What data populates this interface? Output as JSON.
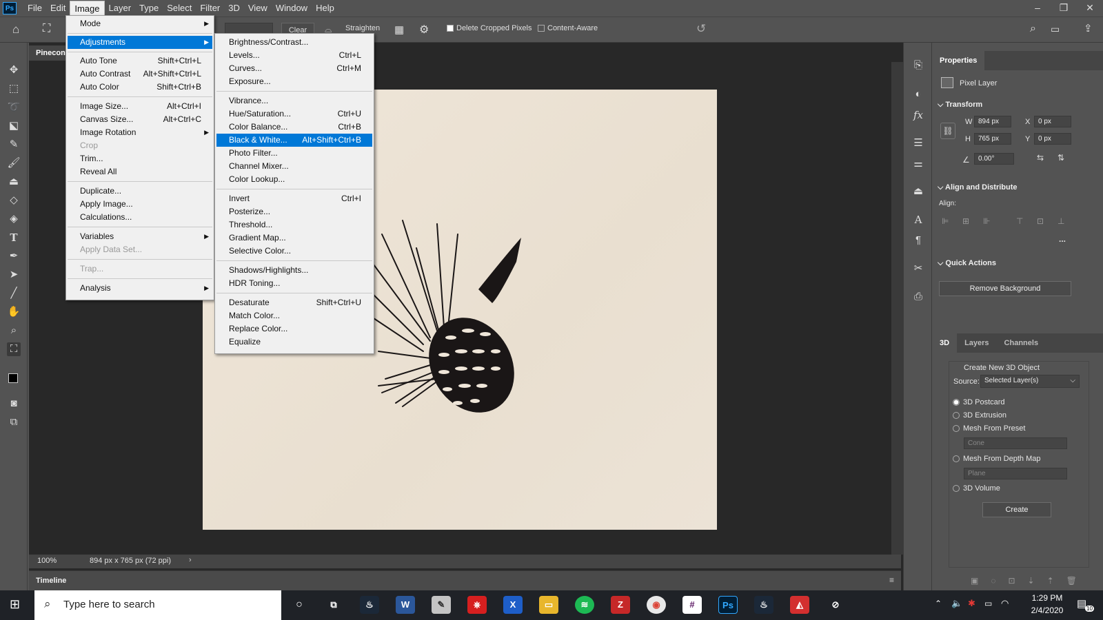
{
  "menubar": {
    "logo": "Ps",
    "items": [
      "File",
      "Edit",
      "Image",
      "Layer",
      "Type",
      "Select",
      "Filter",
      "3D",
      "View",
      "Window",
      "Help"
    ],
    "window_controls": [
      "–",
      "❐",
      "✕"
    ]
  },
  "options": {
    "clear": "Clear",
    "straighten": "Straighten",
    "delete_cropped": "Delete Cropped Pixels",
    "content_aware": "Content-Aware"
  },
  "document": {
    "tab": "Pinecon",
    "zoom": "100%",
    "info": "894 px x 765 px (72 ppi)"
  },
  "timeline": {
    "label": "Timeline"
  },
  "image_menu": {
    "items": [
      {
        "label": "Mode",
        "shortcut": "",
        "sub": "▶"
      },
      {
        "label": "Adjustments",
        "shortcut": "",
        "sub": "▶"
      },
      {
        "label": "Auto Tone",
        "shortcut": "Shift+Ctrl+L",
        "sub": ""
      },
      {
        "label": "Auto Contrast",
        "shortcut": "Alt+Shift+Ctrl+L",
        "sub": ""
      },
      {
        "label": "Auto Color",
        "shortcut": "Shift+Ctrl+B",
        "sub": ""
      },
      {
        "label": "Image Size...",
        "shortcut": "Alt+Ctrl+I",
        "sub": ""
      },
      {
        "label": "Canvas Size...",
        "shortcut": "Alt+Ctrl+C",
        "sub": ""
      },
      {
        "label": "Image Rotation",
        "shortcut": "",
        "sub": "▶"
      },
      {
        "label": "Crop",
        "shortcut": "",
        "sub": ""
      },
      {
        "label": "Trim...",
        "shortcut": "",
        "sub": ""
      },
      {
        "label": "Reveal All",
        "shortcut": "",
        "sub": ""
      },
      {
        "label": "Duplicate...",
        "shortcut": "",
        "sub": ""
      },
      {
        "label": "Apply Image...",
        "shortcut": "",
        "sub": ""
      },
      {
        "label": "Calculations...",
        "shortcut": "",
        "sub": ""
      },
      {
        "label": "Variables",
        "shortcut": "",
        "sub": "▶"
      },
      {
        "label": "Apply Data Set...",
        "shortcut": "",
        "sub": ""
      },
      {
        "label": "Trap...",
        "shortcut": "",
        "sub": ""
      },
      {
        "label": "Analysis",
        "shortcut": "",
        "sub": "▶"
      }
    ]
  },
  "adjust_menu": {
    "items": [
      {
        "label": "Brightness/Contrast...",
        "shortcut": ""
      },
      {
        "label": "Levels...",
        "shortcut": "Ctrl+L"
      },
      {
        "label": "Curves...",
        "shortcut": "Ctrl+M"
      },
      {
        "label": "Exposure...",
        "shortcut": ""
      },
      {
        "label": "Vibrance...",
        "shortcut": ""
      },
      {
        "label": "Hue/Saturation...",
        "shortcut": "Ctrl+U"
      },
      {
        "label": "Color Balance...",
        "shortcut": "Ctrl+B"
      },
      {
        "label": "Black & White...",
        "shortcut": "Alt+Shift+Ctrl+B"
      },
      {
        "label": "Photo Filter...",
        "shortcut": ""
      },
      {
        "label": "Channel Mixer...",
        "shortcut": ""
      },
      {
        "label": "Color Lookup...",
        "shortcut": ""
      },
      {
        "label": "Invert",
        "shortcut": "Ctrl+I"
      },
      {
        "label": "Posterize...",
        "shortcut": ""
      },
      {
        "label": "Threshold...",
        "shortcut": ""
      },
      {
        "label": "Gradient Map...",
        "shortcut": ""
      },
      {
        "label": "Selective Color...",
        "shortcut": ""
      },
      {
        "label": "Shadows/Highlights...",
        "shortcut": ""
      },
      {
        "label": "HDR Toning...",
        "shortcut": ""
      },
      {
        "label": "Desaturate",
        "shortcut": "Shift+Ctrl+U"
      },
      {
        "label": "Match Color...",
        "shortcut": ""
      },
      {
        "label": "Replace Color...",
        "shortcut": ""
      },
      {
        "label": "Equalize",
        "shortcut": ""
      }
    ]
  },
  "properties": {
    "tab": "Properties",
    "layer_type": "Pixel Layer",
    "transform": "Transform",
    "w_label": "W",
    "w": "894 px",
    "h_label": "H",
    "h": "765 px",
    "x_label": "X",
    "x": "0 px",
    "y_label": "Y",
    "y": "0 px",
    "angle": "0.00°",
    "align_distribute": "Align and Distribute",
    "align_label": "Align:",
    "more": "...",
    "quick_actions": "Quick Actions",
    "remove_bg": "Remove Background"
  },
  "panel3d": {
    "tabs": [
      "3D",
      "Layers",
      "Channels"
    ],
    "create_title": "Create New 3D Object",
    "source_label": "Source:",
    "source_value": "Selected Layer(s)",
    "opt_postcard": "3D Postcard",
    "opt_extrusion": "3D Extrusion",
    "opt_mesh_preset": "Mesh From Preset",
    "preset_value": "Cone",
    "opt_depth": "Mesh From Depth Map",
    "depth_value": "Plane",
    "opt_volume": "3D Volume",
    "create": "Create"
  },
  "taskbar": {
    "search": "Type here to search",
    "time": "1:29 PM",
    "date": "2/4/2020",
    "notif": "10"
  },
  "colors": {
    "highlight": "#0078d7",
    "ps_blue": "#31a8ff"
  }
}
